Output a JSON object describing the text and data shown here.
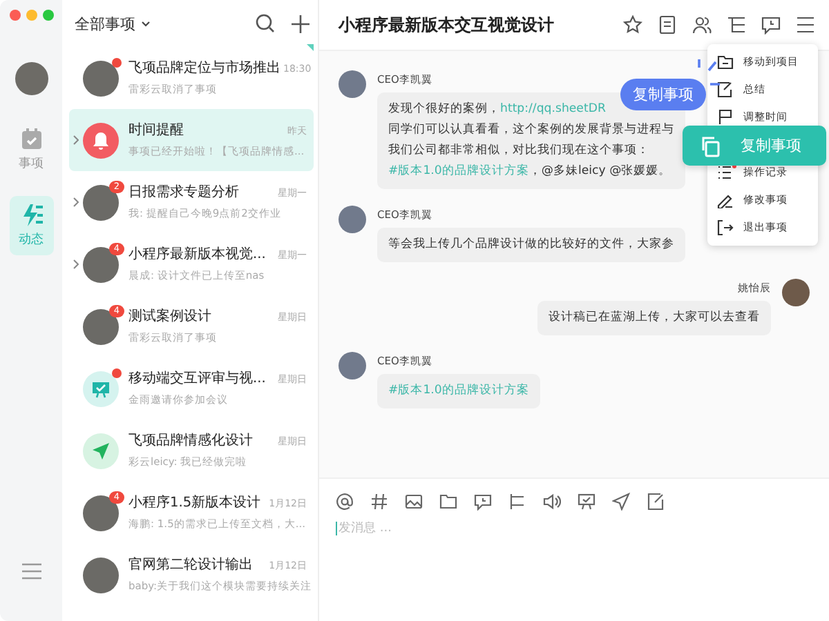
{
  "rail": {
    "items": [
      {
        "label": "事项",
        "selected": false
      },
      {
        "label": "动态",
        "selected": true
      }
    ]
  },
  "list": {
    "title": "全部事项",
    "items": [
      {
        "title": "飞项品牌定位与市场推出",
        "preview": "雷彩云取消了事项",
        "time": "18:30",
        "kind": "photo",
        "selected": false,
        "expandable": false,
        "dot": true,
        "pinned": true
      },
      {
        "title": "时间提醒",
        "preview": "事项已经开始啦！【飞项品牌情感...",
        "time": "昨天",
        "kind": "bell",
        "selected": true,
        "expandable": true,
        "dot": false,
        "pinned": false
      },
      {
        "title": "日报需求专题分析",
        "preview": "我: 提醒自己今晚9点前2交作业",
        "time": "星期一",
        "kind": "photo",
        "badge": "2",
        "selected": false,
        "expandable": true,
        "dot": false,
        "pinned": false
      },
      {
        "title": "小程序最新版本视觉...",
        "preview": "晨成: 设计文件已上传至nas",
        "time": "星期一",
        "kind": "photo",
        "badge": "4",
        "selected": false,
        "expandable": true,
        "dot": false,
        "pinned": false
      },
      {
        "title": "测试案例设计",
        "preview": "雷彩云取消了事项",
        "time": "星期日",
        "kind": "photo",
        "badge": "4",
        "selected": false,
        "expandable": false,
        "dot": false,
        "pinned": false
      },
      {
        "title": "移动端交互评审与视...",
        "preview": "金雨邀请你参加会议",
        "time": "星期日",
        "kind": "meeting",
        "selected": false,
        "expandable": false,
        "dot": true,
        "pinned": false
      },
      {
        "title": "飞项品牌情感化设计",
        "preview": "彩云leicy: 我已经做完啦",
        "time": "星期日",
        "kind": "send",
        "selected": false,
        "expandable": false,
        "dot": false,
        "pinned": false
      },
      {
        "title": "小程序1.5新版本设计",
        "preview": "海鹏: 1.5的需求已上传至文档，大...",
        "time": "1月12日",
        "kind": "photo",
        "badge": "4",
        "selected": false,
        "expandable": false,
        "dot": false,
        "pinned": false
      },
      {
        "title": "官网第二轮设计输出",
        "preview": "baby:关于我们这个模块需要持续关注",
        "time": "1月12日",
        "kind": "photo",
        "selected": false,
        "expandable": false,
        "dot": false,
        "pinned": false
      }
    ]
  },
  "chat": {
    "title": "小程序最新版本交互视觉设计",
    "messages": [
      {
        "sender": "CEO李凯翼",
        "mine": false,
        "lines": [
          [
            {
              "kind": "text",
              "text": "发现个很好的案例，"
            },
            {
              "kind": "link",
              "text": "http://qq.sheetDR"
            }
          ],
          [
            {
              "kind": "text",
              "text": "同学们可以认真看看，这个案例的发展背景与进程与"
            }
          ],
          [
            {
              "kind": "text",
              "text": "我们公司都非常相似，对比我们现在这个事项："
            }
          ],
          [
            {
              "kind": "tag",
              "text": "#版本1.0的品牌设计方案"
            },
            {
              "kind": "text",
              "text": "，@多妹leicy @张媛媛。"
            }
          ]
        ]
      },
      {
        "sender": "CEO李凯翼",
        "mine": false,
        "lines": [
          [
            {
              "kind": "text",
              "text": "等会我上传几个品牌设计做的比较好的文件，大家参"
            }
          ]
        ]
      },
      {
        "sender": "姚怡辰",
        "mine": true,
        "lines": [
          [
            {
              "kind": "text",
              "text": "设计稿已在蓝湖上传，大家可以去查看"
            }
          ]
        ]
      },
      {
        "sender": "CEO李凯翼",
        "mine": false,
        "lines": [
          [
            {
              "kind": "tag",
              "text": "#版本1.0的品牌设计方案"
            }
          ]
        ]
      }
    ],
    "input": {
      "placeholder": "发消息 ..."
    }
  },
  "menu": {
    "items": [
      {
        "label": "移动到项目",
        "highlighted": false,
        "dot": false
      },
      {
        "label": "总结",
        "highlighted": false,
        "dot": false
      },
      {
        "label": "调整时间",
        "highlighted": false,
        "dot": false
      },
      {
        "label": "复制事项",
        "highlighted": true,
        "dot": false
      },
      {
        "label": "操作记录",
        "highlighted": false,
        "dot": true
      },
      {
        "label": "修改事项",
        "highlighted": false,
        "dot": false
      },
      {
        "label": "退出事项",
        "highlighted": false,
        "dot": false
      }
    ]
  },
  "tooltip": {
    "text": "复制事项"
  }
}
